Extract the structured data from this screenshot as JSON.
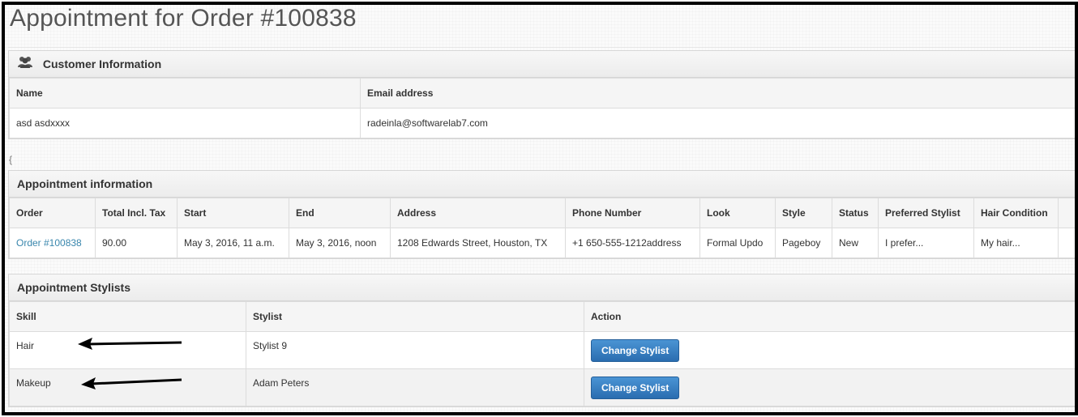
{
  "page": {
    "title": "Appointment for Order #100838"
  },
  "customer": {
    "heading": "Customer Information",
    "icon": "users-icon",
    "columns": [
      "Name",
      "Email address"
    ],
    "row": {
      "name": "asd asdxxxx",
      "email": "radeinla@softwarelab7.com"
    }
  },
  "stray_text": "{",
  "appointment": {
    "heading": "Appointment information",
    "columns": [
      "Order",
      "Total Incl. Tax",
      "Start",
      "End",
      "Address",
      "Phone Number",
      "Look",
      "Style",
      "Status",
      "Preferred Stylist",
      "Hair Condition"
    ],
    "row": {
      "order": "Order #100838",
      "total": "90.00",
      "start": "May 3, 2016, 11 a.m.",
      "end": "May 3, 2016, noon",
      "address": "1208 Edwards Street, Houston, TX",
      "phone": "+1 650-555-1212address",
      "look": "Formal Updo",
      "style": "Pageboy",
      "status": "New",
      "preferred_stylist": "I prefer...",
      "hair_condition": "My hair..."
    }
  },
  "stylists": {
    "heading": "Appointment Stylists",
    "columns": [
      "Skill",
      "Stylist",
      "Action"
    ],
    "rows": [
      {
        "skill": "Hair",
        "stylist": "Stylist 9",
        "action": "Change Stylist"
      },
      {
        "skill": "Makeup",
        "stylist": "Adam Peters",
        "action": "Change Stylist"
      }
    ]
  },
  "colors": {
    "link": "#3a87ad",
    "button": "#2f78bd",
    "frame_border": "#000000"
  }
}
